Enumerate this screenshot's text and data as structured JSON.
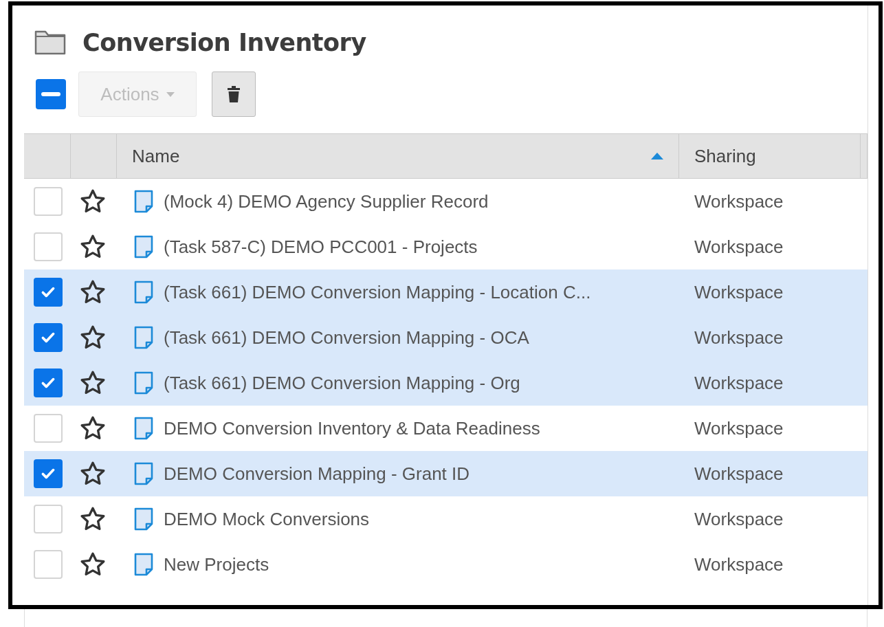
{
  "header": {
    "title": "Conversion Inventory"
  },
  "toolbar": {
    "select_all": {
      "indeterminate": true
    },
    "actions_button": {
      "label": "Actions",
      "disabled": true
    }
  },
  "table": {
    "columns": [
      {
        "label": "Name",
        "sorted": true
      },
      {
        "label": "Sharing",
        "sorted": false
      }
    ],
    "rows": [
      {
        "name": "(Mock 4) DEMO Agency Supplier Record",
        "sharing": "Workspace",
        "selected": false,
        "starred": false
      },
      {
        "name": "(Task 587-C) DEMO PCC001 - Projects",
        "sharing": "Workspace",
        "selected": false,
        "starred": false
      },
      {
        "name": "(Task 661) DEMO Conversion Mapping - Location C...",
        "sharing": "Workspace",
        "selected": true,
        "starred": false
      },
      {
        "name": "(Task 661) DEMO Conversion Mapping - OCA",
        "sharing": "Workspace",
        "selected": true,
        "starred": false
      },
      {
        "name": "(Task 661) DEMO Conversion Mapping - Org",
        "sharing": "Workspace",
        "selected": true,
        "starred": false
      },
      {
        "name": "DEMO Conversion Inventory & Data Readiness",
        "sharing": "Workspace",
        "selected": false,
        "starred": false
      },
      {
        "name": "DEMO Conversion Mapping - Grant ID",
        "sharing": "Workspace",
        "selected": true,
        "starred": false
      },
      {
        "name": "DEMO Mock Conversions",
        "sharing": "Workspace",
        "selected": false,
        "starred": false
      },
      {
        "name": "New Projects",
        "sharing": "Workspace",
        "selected": false,
        "starred": false
      }
    ]
  }
}
